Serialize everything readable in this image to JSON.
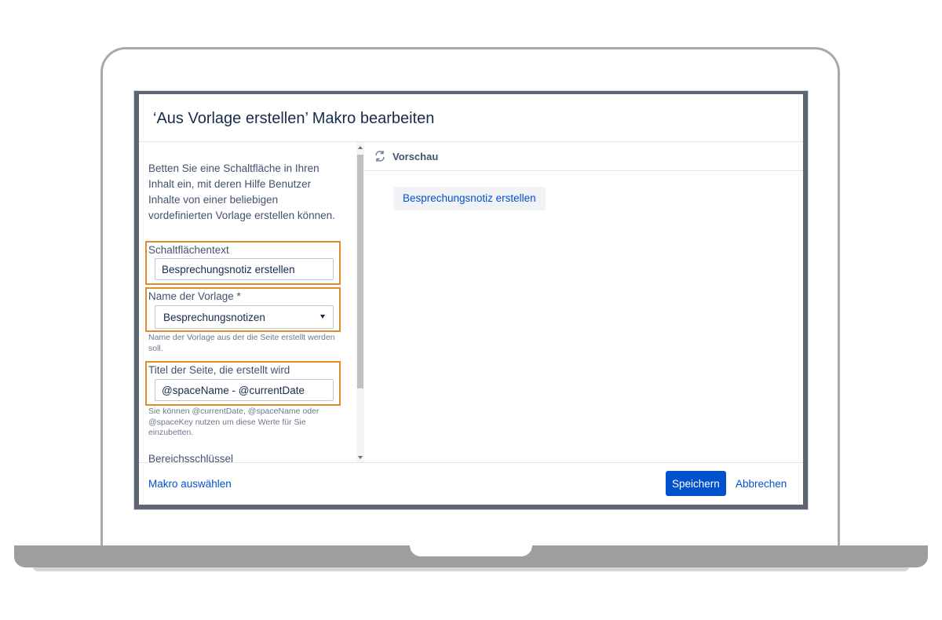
{
  "dialog": {
    "title": "‘Aus Vorlage erstellen’ Makro bearbeiten"
  },
  "form": {
    "description": "Betten Sie eine Schaltfläche in Ihren Inhalt ein, mit deren Hilfe Benutzer Inhalte von einer beliebigen vordefinierten Vorlage erstellen können.",
    "button_text_label": "Schaltflächentext",
    "button_text_value": "Besprechungsnotiz erstellen",
    "template_label": "Name der Vorlage *",
    "template_value": "Besprechungsnotizen",
    "template_help": "Name der Vorlage aus der die Seite erstellt werden soll.",
    "page_title_label": "Titel der Seite, die erstellt wird",
    "page_title_value": "@spaceName - @currentDate",
    "page_title_help": "Sie können @currentDate, @spaceName oder @spaceKey nutzen um diese Werte für Sie einzubetten.",
    "space_key_label": "Bereichsschlüssel"
  },
  "preview": {
    "label": "Vorschau",
    "button_label": "Besprechungsnotiz erstellen",
    "icon": "refresh-icon"
  },
  "footer": {
    "select_macro_link": "Makro auswählen",
    "save_label": "Speichern",
    "cancel_label": "Abbrechen"
  },
  "colors": {
    "accent": "#0052cc",
    "highlight": "#e18b2b",
    "text": "#172b4d"
  }
}
